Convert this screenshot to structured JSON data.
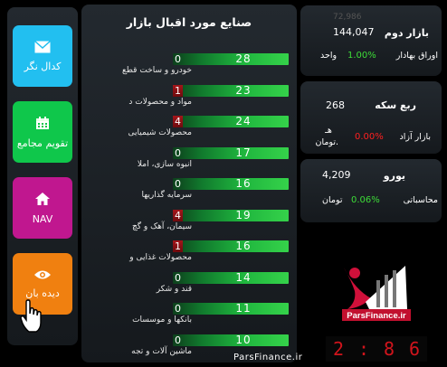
{
  "menu": {
    "tiles": [
      {
        "label": "کدال نگر",
        "icon": "envelope-icon",
        "color": "#22bff0"
      },
      {
        "label": "تقویم مجامع",
        "icon": "calendar-icon",
        "color": "#0fc74b"
      },
      {
        "label": "NAV",
        "icon": "home-icon",
        "color": "#c0178f"
      },
      {
        "label": "دیده بان",
        "icon": "eye-icon",
        "color": "#f08010"
      }
    ]
  },
  "industries": {
    "title": "صنایع مورد اقبال بازار",
    "rows": [
      {
        "label": "خودرو و ساخت قطع",
        "negative": "0",
        "positive": "28"
      },
      {
        "label": "مواد و محصولات د",
        "negative": "1",
        "positive": "23"
      },
      {
        "label": "محصولات شیمیایی",
        "negative": "4",
        "positive": "24"
      },
      {
        "label": "انبوه سازی، املا",
        "negative": "0",
        "positive": "17"
      },
      {
        "label": "سرمایه گذاریها",
        "negative": "0",
        "positive": "16"
      },
      {
        "label": "سیمان، آهک و گچ",
        "negative": "4",
        "positive": "19"
      },
      {
        "label": "محصولات غذایی و",
        "negative": "1",
        "positive": "16"
      },
      {
        "label": "قند و شکر",
        "negative": "0",
        "positive": "14"
      },
      {
        "label": "بانکها و موسسات",
        "negative": "0",
        "positive": "11"
      },
      {
        "label": "ماشین آلات و تجه",
        "negative": "0",
        "positive": "10"
      }
    ]
  },
  "cards": {
    "bond": {
      "title": "بازار دوم",
      "value": "144,047",
      "pct": "1.00%",
      "unit": "واحد",
      "name": "اوراق بهادار",
      "faded": "72,986"
    },
    "coin": {
      "title": "ربع سکه",
      "value": "268",
      "pct": "0.00%",
      "unit": "هـ .تومان",
      "name": "بازار آزاد"
    },
    "euro": {
      "title": "یورو",
      "value": "4,209",
      "pct": "0.06%",
      "unit": "تومان",
      "name": "محاسباتی"
    }
  },
  "brand": {
    "name": "ParsFinance.ir",
    "url": "ParsFinance.ir"
  },
  "clock": {
    "h": "2",
    "m1": "8",
    "m2": "6"
  },
  "colors": {
    "up": "#3ddc38",
    "down": "#ff2020",
    "bar_green": "#2fcf49",
    "bar_red": "#a3151a"
  }
}
